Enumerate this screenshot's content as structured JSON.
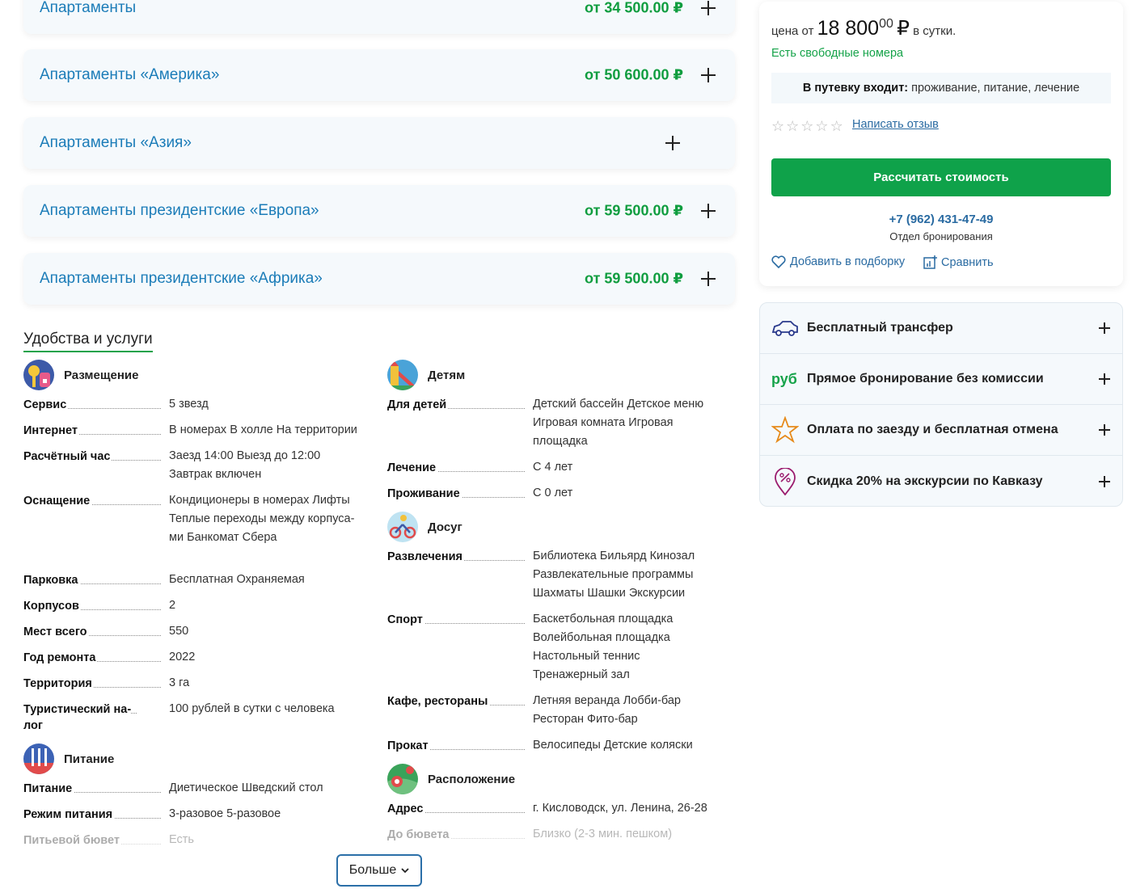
{
  "rooms": [
    {
      "name": "Апартаменты",
      "price": "от 34 500.00 ₽"
    },
    {
      "name": "Апартаменты «Америка»",
      "price": "от 50 600.00 ₽"
    },
    {
      "name": "Апартаменты «Азия»",
      "price": ""
    },
    {
      "name": "Апартаменты президентские «Европа»",
      "price": "от 59 500.00 ₽"
    },
    {
      "name": "Апартаменты президентские «Африка»",
      "price": "от 59 500.00 ₽"
    }
  ],
  "amenities": {
    "title": "Удобства и услуги",
    "more_label": "Больше",
    "left": {
      "placement": {
        "label": "Размещение",
        "rows": [
          {
            "label": "Сервис",
            "value": "5 звезд"
          },
          {
            "label": "Интернет",
            "value": "В номерах В холле На территории"
          },
          {
            "label": "Расчётный час",
            "value": "Заезд 14:00 Выезд до 12:00 Завтрак включен"
          },
          {
            "label": "Оснащение",
            "value": "Кондиционеры в номерах Лифты Теплые переходы между корпуса-ми Банкомат Сбера"
          },
          {
            "label": "Парковка",
            "value": "Бесплатная Охраняемая"
          },
          {
            "label": "Корпусов",
            "value": "2"
          },
          {
            "label": "Мест всего",
            "value": "550"
          },
          {
            "label": "Год ремонта",
            "value": "2022"
          },
          {
            "label": "Территория",
            "value": "3 га"
          },
          {
            "label": "Туристический на-лог",
            "value": "100 рублей в сутки с человека"
          }
        ]
      },
      "food": {
        "label": "Питание",
        "rows": [
          {
            "label": "Питание",
            "value": "Диетическое Шведский стол"
          },
          {
            "label": "Режим питания",
            "value": "3-разовое 5-разовое"
          },
          {
            "label": "Питьевой бювет",
            "value": "Есть"
          }
        ]
      }
    },
    "right": {
      "kids": {
        "label": "Детям",
        "rows": [
          {
            "label": "Для детей",
            "value": "Детский бассейн Детское меню Игровая комната Игровая площадка"
          },
          {
            "label": "Лечение",
            "value": "С 4 лет"
          },
          {
            "label": "Проживание",
            "value": "С 0 лет"
          }
        ]
      },
      "leisure": {
        "label": "Досуг",
        "rows": [
          {
            "label": "Развлечения",
            "value": "Библиотека Бильярд Кинозал Развлекательные программы Шахматы Шашки Экскурсии"
          },
          {
            "label": "Спорт",
            "value": "Баскетбольная площадка Волейбольная площадка Настольный теннис Тренажерный зал"
          },
          {
            "label": "Кафе, рестораны",
            "value": "Летняя веранда Лобби-бар Ресторан Фито-бар"
          },
          {
            "label": "Прокат",
            "value": "Велосипеды Детские коляски"
          }
        ]
      },
      "location": {
        "label": "Расположение",
        "rows": [
          {
            "label": "Адрес",
            "value": "г. Кисловодск, ул. Ленина, 26-28"
          },
          {
            "label": "До бювета",
            "value": "Близко (2-3 мин. пешком)"
          }
        ]
      }
    }
  },
  "price_card": {
    "price_prefix": "цена от",
    "price_rub": "18 800",
    "price_kop": "00",
    "price_currency": "₽",
    "price_suffix": "в сутки.",
    "availability": "Есть свободные номера",
    "includes_label": "В путевку входит:",
    "includes_value": "проживание, питание, лечение",
    "rating_stars": 0,
    "review_link": "Написать отзыв",
    "calc_button": "Рассчитать стоимость",
    "phone": "+7 (962) 431-47-49",
    "phone_caption": "Отдел бронирования",
    "add_favorites": "Добавить в подборку",
    "compare": "Сравнить"
  },
  "perks": [
    {
      "icon": "car-icon",
      "label": "Бесплатный трансфер"
    },
    {
      "icon": "rub-icon",
      "icon_text": "руб",
      "label": "Прямое бронирование без комиссии"
    },
    {
      "icon": "star-icon",
      "label": "Оплата по заезду и бесплатная отмена"
    },
    {
      "icon": "discount-pin-icon",
      "label": "Скидка 20% на экскурсии по Кавказу"
    }
  ],
  "colors": {
    "green": "#0fa24a",
    "blue": "#1b7cb8",
    "link": "#2a6ba2"
  }
}
